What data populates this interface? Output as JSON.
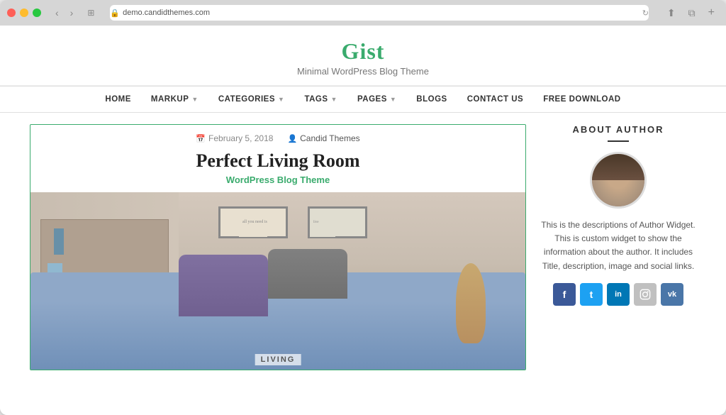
{
  "browser": {
    "url": "demo.candidthemes.com",
    "lock_icon": "🔒"
  },
  "site": {
    "title": "Gist",
    "tagline": "Minimal WordPress Blog Theme"
  },
  "nav": {
    "items": [
      {
        "label": "HOME",
        "has_arrow": false
      },
      {
        "label": "MARKUP",
        "has_arrow": true
      },
      {
        "label": "CATEGORIES",
        "has_arrow": true
      },
      {
        "label": "TAGS",
        "has_arrow": true
      },
      {
        "label": "PAGES",
        "has_arrow": true
      },
      {
        "label": "BLOGS",
        "has_arrow": false
      },
      {
        "label": "CONTACT US",
        "has_arrow": false
      },
      {
        "label": "FREE DOWNLOAD",
        "has_arrow": false
      }
    ]
  },
  "article": {
    "date": "February 5, 2018",
    "author": "Candid Themes",
    "title": "Perfect Living Room",
    "subtitle": "WordPress Blog Theme",
    "image_caption": "LIVING"
  },
  "sidebar": {
    "about_title": "ABOUT AUTHOR",
    "author_description": "This is the descriptions of Author Widget. This is custom widget to show the information about the author. It includes Title, description, image and social links.",
    "social": {
      "facebook": "f",
      "twitter": "t",
      "linkedin": "in",
      "instagram": "📷",
      "vk": "vk"
    }
  }
}
